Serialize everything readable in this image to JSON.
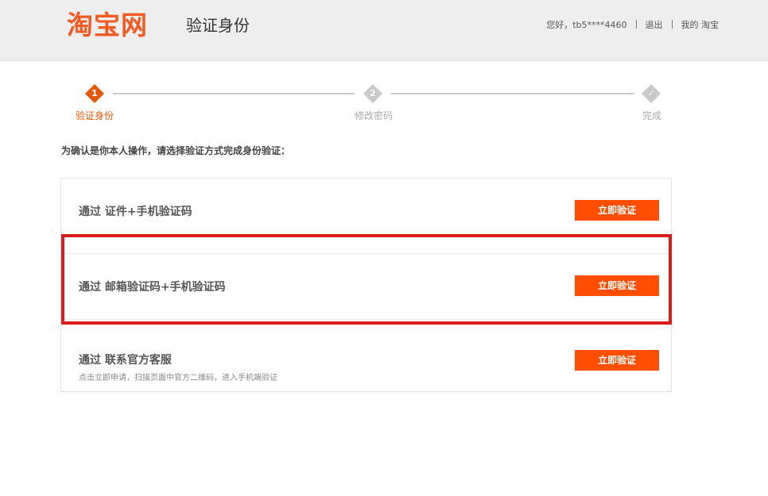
{
  "header": {
    "logo_text": "淘宝网",
    "page_title": "验证身份",
    "greeting": "您好，tb5****4460",
    "logout_label": "退出",
    "my_taobao_label": "我的 淘宝"
  },
  "steps": [
    {
      "number": "1",
      "label": "验证身份",
      "state": "active"
    },
    {
      "number": "2",
      "label": "修改密码",
      "state": "pending"
    },
    {
      "number": "✓",
      "label": "完成",
      "state": "pending"
    }
  ],
  "instruction": "为确认是你本人操作，请选择验证方式完成身份验证：",
  "options": [
    {
      "title": "通过 证件+手机验证码",
      "description": "",
      "button_label": "立即验证"
    },
    {
      "title": "通过 邮箱验证码+手机验证码",
      "description": "",
      "button_label": "立即验证"
    },
    {
      "title": "通过 联系官方客服",
      "description": "点击立即申请，扫描页面中官方二维码，进入手机端验证",
      "button_label": "立即验证"
    }
  ],
  "colors": {
    "brand": "#ff4d01",
    "logo": "#f15a22",
    "active_step": "#e4590c",
    "inactive_step": "#c9c9c9",
    "highlight": "#dc1b1b"
  }
}
